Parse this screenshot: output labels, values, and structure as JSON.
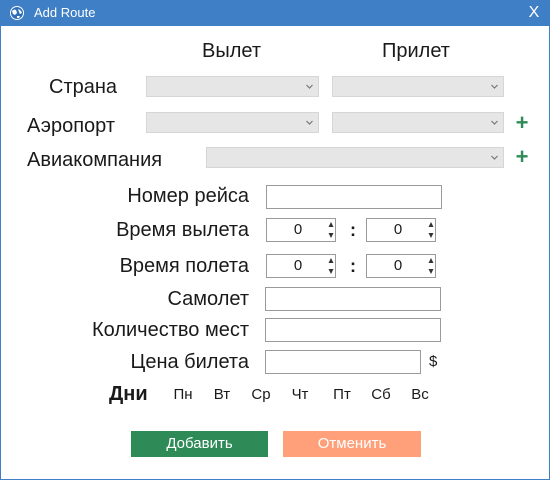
{
  "window": {
    "title": "Add Route",
    "close_glyph": "X",
    "titlebar_color": "#3f7fc6"
  },
  "columns": {
    "departure": "Вылет",
    "arrival": "Прилет"
  },
  "fields": {
    "country_label": "Страна",
    "airport_label": "Аэропорт",
    "airline_label": "Авиакомпания",
    "flight_number_label": "Номер рейса",
    "departure_time_label": "Время вылета",
    "flight_duration_label": "Время полета",
    "aircraft_label": "Самолет",
    "seats_label": "Количество мест",
    "price_label": "Цена билета",
    "currency": "$",
    "time_separator": ":"
  },
  "values": {
    "departure_hours": "0",
    "departure_minutes": "0",
    "duration_hours": "0",
    "duration_minutes": "0"
  },
  "add_glyph": "+",
  "days": {
    "label": "Дни",
    "items": [
      "Пн",
      "Вт",
      "Ср",
      "Чт",
      "Пт",
      "Сб",
      "Вс"
    ]
  },
  "buttons": {
    "add": "Добавить",
    "cancel": "Отменить",
    "add_color": "#2e8b57",
    "cancel_color": "#ffa07a"
  },
  "icons": {
    "app": "globe-icon",
    "close": "close-icon",
    "dropdown": "chevron-down-icon",
    "add": "plus-icon",
    "spin_up": "triangle-up-icon",
    "spin_down": "triangle-down-icon"
  }
}
